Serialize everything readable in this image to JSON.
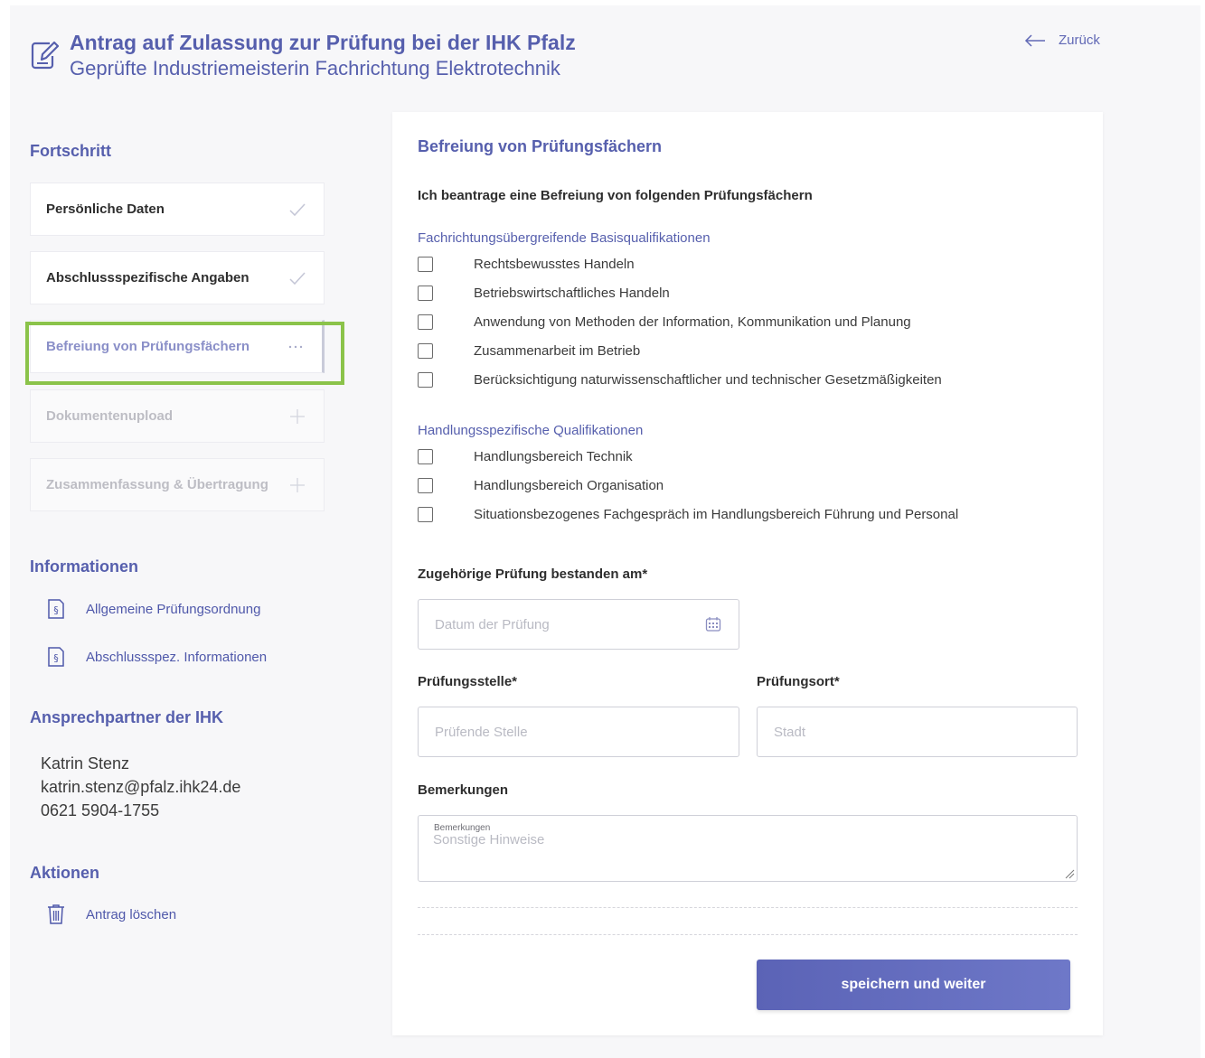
{
  "header": {
    "title": "Antrag auf Zulassung zur Prüfung bei der IHK Pfalz",
    "subtitle": "Geprüfte Industriemeisterin Fachrichtung Elektrotechnik",
    "back_label": "Zurück"
  },
  "sidebar": {
    "progress_heading": "Fortschritt",
    "steps": [
      {
        "label": "Persönliche Daten",
        "state": "done"
      },
      {
        "label": "Abschlussspezifische Angaben",
        "state": "done"
      },
      {
        "label": "Befreiung von Prüfungsfächern",
        "state": "active"
      },
      {
        "label": "Dokumentenupload",
        "state": "future"
      },
      {
        "label": "Zusammenfassung & Übertragung",
        "state": "future"
      }
    ],
    "info_heading": "Informationen",
    "info_links": [
      {
        "label": "Allgemeine Prüfungsordnung",
        "icon": "paragraph-document-icon"
      },
      {
        "label": "Abschlussspez. Informationen",
        "icon": "paragraph-document-icon"
      }
    ],
    "contact_heading": "Ansprechpartner der IHK",
    "contact": {
      "name": "Katrin Stenz",
      "email": "katrin.stenz@pfalz.ihk24.de",
      "phone": "0621 5904-1755"
    },
    "actions_heading": "Aktionen",
    "actions": [
      {
        "label": "Antrag löschen",
        "icon": "trash-icon"
      }
    ]
  },
  "main": {
    "title": "Befreiung von Prüfungsfächern",
    "intro": "Ich beantrage eine Befreiung von folgenden Prüfungsfächern",
    "groups": [
      {
        "title": "Fachrichtungsübergreifende Basisqualifikationen",
        "items": [
          "Rechtsbewusstes Handeln",
          "Betriebswirtschaftliches Handeln",
          "Anwendung von Methoden der Information, Kommunikation und Planung",
          "Zusammenarbeit im Betrieb",
          "Berücksichtigung naturwissenschaftlicher und technischer Gesetzmäßigkeiten"
        ]
      },
      {
        "title": "Handlungsspezifische Qualifikationen",
        "items": [
          "Handlungsbereich Technik",
          "Handlungsbereich Organisation",
          "Situationsbezogenes Fachgespräch im Handlungsbereich Führung und Personal"
        ]
      }
    ],
    "date_label": "Zugehörige Prüfung bestanden am*",
    "date_placeholder": "Datum der Prüfung",
    "stelle_label": "Prüfungsstelle*",
    "stelle_placeholder": "Prüfende Stelle",
    "ort_label": "Prüfungsort*",
    "ort_placeholder": "Stadt",
    "remarks_label": "Bemerkungen",
    "remarks_inner_label": "Bemerkungen",
    "remarks_placeholder": "Sonstige Hinweise",
    "submit_label": "speichern und weiter"
  },
  "colors": {
    "accent": "#565fad",
    "highlight": "#8bc34a",
    "button": "#6068b8"
  }
}
